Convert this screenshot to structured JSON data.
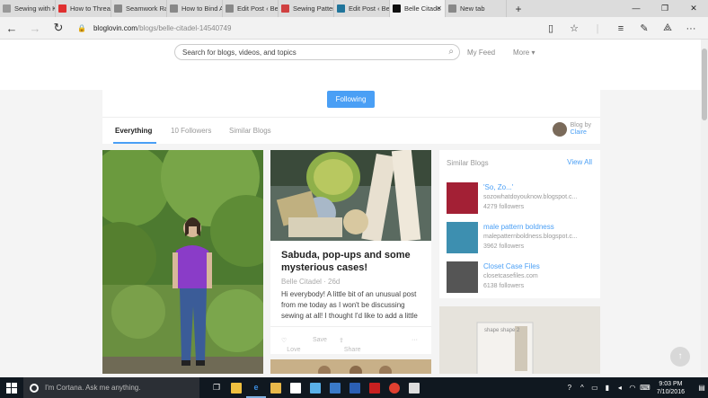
{
  "tabs": [
    {
      "label": "Sewing with Kn",
      "icon_color": "#999999",
      "active": false
    },
    {
      "label": "How to Thread",
      "icon_color": "#e03030",
      "active": false
    },
    {
      "label": "Seamwork Rad",
      "icon_color": "#888888",
      "active": false
    },
    {
      "label": "How to Bind A",
      "icon_color": "#888888",
      "active": false
    },
    {
      "label": "Edit Post ‹ Belle",
      "icon_color": "#888888",
      "active": false
    },
    {
      "label": "Sewing Pattern",
      "icon_color": "#d04040",
      "active": false
    },
    {
      "label": "Edit Post ‹ Belle",
      "icon_color": "#21759b",
      "active": false
    },
    {
      "label": "Belle Citade",
      "icon_color": "#111111",
      "active": true
    },
    {
      "label": "New tab",
      "icon_color": "#888888",
      "active": false
    }
  ],
  "address": {
    "domain": "bloglovin.com",
    "path": "/blogs/belle-citadel-14540749"
  },
  "search": {
    "placeholder": "Search for blogs, videos, and topics"
  },
  "nav": {
    "my_feed": "My Feed",
    "more": "More ▾"
  },
  "profile": {
    "follow_label": "Following",
    "tabs": [
      "Everything",
      "10 Followers",
      "Similar Blogs"
    ],
    "blog_by_label": "Blog by",
    "blog_by_name": "Claire"
  },
  "post": {
    "title": "Sabuda, pop-ups and some mysterious cases!",
    "author": "Belle Citadel",
    "age": "26d",
    "excerpt": "Hi everybody! A little bit of an unusual post from me today as I won't be discussing sewing at all! I thought I'd like to add a little",
    "actions": {
      "love": "Love",
      "save": "Save",
      "share": "Share",
      "more": "···"
    }
  },
  "similar": {
    "heading": "Similar Blogs",
    "view_all": "View All",
    "items": [
      {
        "name": "'So, Zo...'",
        "url": "sozowhatdoyouknow.blogspot.c...",
        "followers": "4279 followers",
        "color": "#a32035"
      },
      {
        "name": "male pattern boldness",
        "url": "malepatternboldness.blogspot.c...",
        "followers": "3962 followers",
        "color": "#3d8fb0"
      },
      {
        "name": "Closet Case Files",
        "url": "closetcasefiles.com",
        "followers": "6138 followers",
        "color": "#555555"
      }
    ]
  },
  "book_text": "shape shape 2",
  "taskbar": {
    "cortana_placeholder": "I'm Cortana. Ask me anything.",
    "time": "9:03 PM",
    "date": "7/10/2016"
  }
}
